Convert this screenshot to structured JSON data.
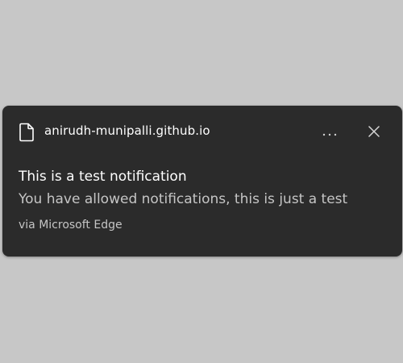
{
  "notification": {
    "source": "anirudh-munipalli.github.io",
    "source_icon": "document-icon",
    "more_icon": "more-options-icon",
    "close_icon": "close-icon",
    "title": "This is a test notification",
    "body": "You have allowed notifications, this is just a test",
    "attribution": "via Microsoft Edge"
  },
  "colors": {
    "background": "#c7c7c7",
    "toast_background": "#2b2b2b",
    "title_text": "#ffffff",
    "secondary_text": "#c5c5c5"
  }
}
